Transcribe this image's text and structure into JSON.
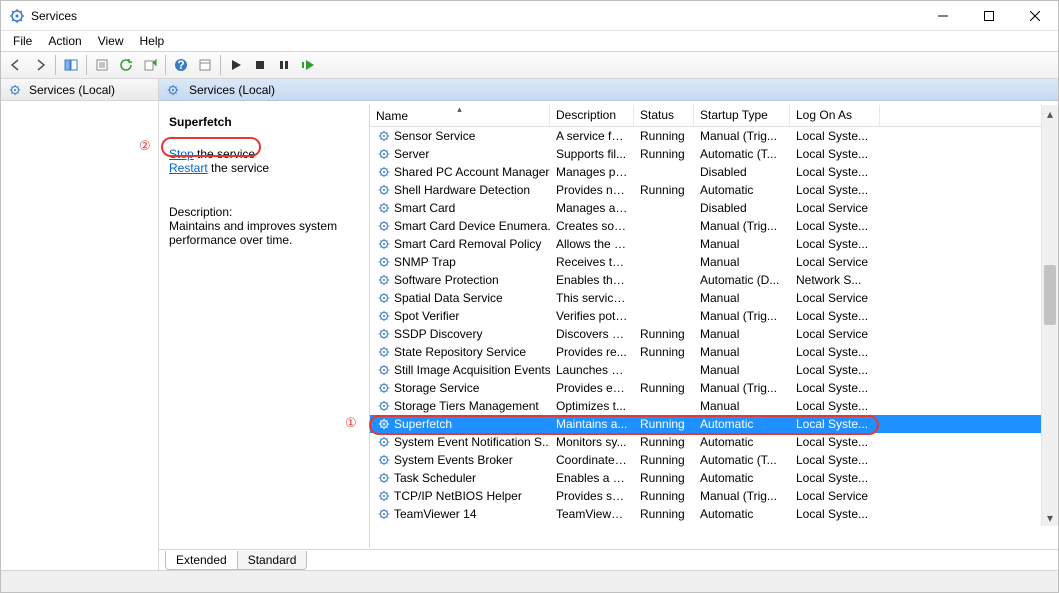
{
  "window": {
    "title": "Services"
  },
  "menu": {
    "file": "File",
    "action": "Action",
    "view": "View",
    "help": "Help"
  },
  "tree": {
    "root": "Services (Local)"
  },
  "panelhead": "Services (Local)",
  "detail": {
    "name": "Superfetch",
    "stop_label": "Stop",
    "stop_suffix": " the service",
    "restart_label": "Restart",
    "restart_suffix": " the service",
    "desc_head": "Description:",
    "desc_body": "Maintains and improves system performance over time."
  },
  "columns": {
    "name": "Name",
    "desc": "Description",
    "status": "Status",
    "start": "Startup Type",
    "logon": "Log On As"
  },
  "tabs": {
    "extended": "Extended",
    "standard": "Standard"
  },
  "annotations": {
    "one": "①",
    "two": "②"
  },
  "rows": [
    {
      "name": "Sensor Service",
      "desc": "A service fo...",
      "status": "Running",
      "start": "Manual (Trig...",
      "logon": "Local Syste..."
    },
    {
      "name": "Server",
      "desc": "Supports fil...",
      "status": "Running",
      "start": "Automatic (T...",
      "logon": "Local Syste..."
    },
    {
      "name": "Shared PC Account Manager",
      "desc": "Manages pr...",
      "status": "",
      "start": "Disabled",
      "logon": "Local Syste..."
    },
    {
      "name": "Shell Hardware Detection",
      "desc": "Provides no...",
      "status": "Running",
      "start": "Automatic",
      "logon": "Local Syste..."
    },
    {
      "name": "Smart Card",
      "desc": "Manages ac...",
      "status": "",
      "start": "Disabled",
      "logon": "Local Service"
    },
    {
      "name": "Smart Card Device Enumera...",
      "desc": "Creates soft...",
      "status": "",
      "start": "Manual (Trig...",
      "logon": "Local Syste..."
    },
    {
      "name": "Smart Card Removal Policy",
      "desc": "Allows the s...",
      "status": "",
      "start": "Manual",
      "logon": "Local Syste..."
    },
    {
      "name": "SNMP Trap",
      "desc": "Receives tra...",
      "status": "",
      "start": "Manual",
      "logon": "Local Service"
    },
    {
      "name": "Software Protection",
      "desc": "Enables the ...",
      "status": "",
      "start": "Automatic (D...",
      "logon": "Network S..."
    },
    {
      "name": "Spatial Data Service",
      "desc": "This service ...",
      "status": "",
      "start": "Manual",
      "logon": "Local Service"
    },
    {
      "name": "Spot Verifier",
      "desc": "Verifies pote...",
      "status": "",
      "start": "Manual (Trig...",
      "logon": "Local Syste..."
    },
    {
      "name": "SSDP Discovery",
      "desc": "Discovers n...",
      "status": "Running",
      "start": "Manual",
      "logon": "Local Service"
    },
    {
      "name": "State Repository Service",
      "desc": "Provides re...",
      "status": "Running",
      "start": "Manual",
      "logon": "Local Syste..."
    },
    {
      "name": "Still Image Acquisition Events",
      "desc": "Launches a...",
      "status": "",
      "start": "Manual",
      "logon": "Local Syste..."
    },
    {
      "name": "Storage Service",
      "desc": "Provides en...",
      "status": "Running",
      "start": "Manual (Trig...",
      "logon": "Local Syste..."
    },
    {
      "name": "Storage Tiers Management",
      "desc": "Optimizes t...",
      "status": "",
      "start": "Manual",
      "logon": "Local Syste..."
    },
    {
      "name": "Superfetch",
      "desc": "Maintains a...",
      "status": "Running",
      "start": "Automatic",
      "logon": "Local Syste...",
      "selected": true
    },
    {
      "name": "System Event Notification S...",
      "desc": "Monitors sy...",
      "status": "Running",
      "start": "Automatic",
      "logon": "Local Syste..."
    },
    {
      "name": "System Events Broker",
      "desc": "Coordinates...",
      "status": "Running",
      "start": "Automatic (T...",
      "logon": "Local Syste..."
    },
    {
      "name": "Task Scheduler",
      "desc": "Enables a us...",
      "status": "Running",
      "start": "Automatic",
      "logon": "Local Syste..."
    },
    {
      "name": "TCP/IP NetBIOS Helper",
      "desc": "Provides su...",
      "status": "Running",
      "start": "Manual (Trig...",
      "logon": "Local Service"
    },
    {
      "name": "TeamViewer 14",
      "desc": "TeamViewer...",
      "status": "Running",
      "start": "Automatic",
      "logon": "Local Syste..."
    }
  ]
}
